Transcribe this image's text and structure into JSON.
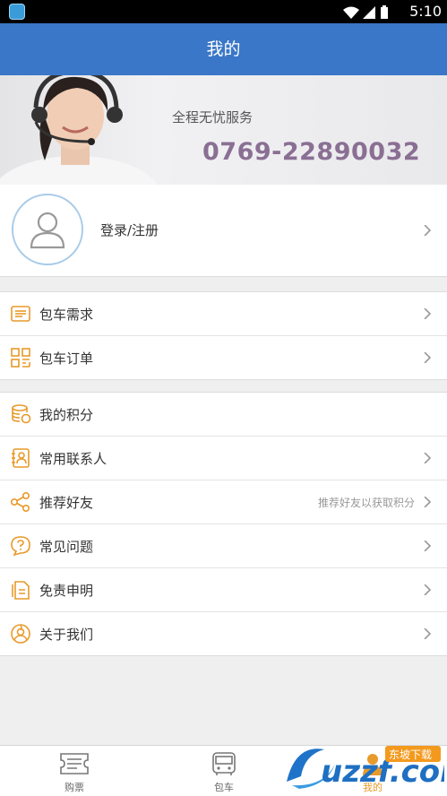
{
  "status_bar": {
    "time": "5:10"
  },
  "header": {
    "title": "我的"
  },
  "banner": {
    "slogan": "全程无忧服务",
    "phone": "0769-22890032"
  },
  "profile": {
    "login_label": "登录/注册"
  },
  "groups": [
    {
      "items": [
        {
          "label": "包车需求",
          "icon": "ticket-list-icon"
        },
        {
          "label": "包车订单",
          "icon": "qr-grid-icon"
        }
      ]
    },
    {
      "items": [
        {
          "label": "我的积分",
          "icon": "coin-stack-icon"
        },
        {
          "label": "常用联系人",
          "icon": "contact-card-icon"
        },
        {
          "label": "推荐好友",
          "icon": "share-icon",
          "hint": "推荐好友以获取积分"
        },
        {
          "label": "常见问题",
          "icon": "question-icon"
        },
        {
          "label": "免责申明",
          "icon": "document-icon"
        },
        {
          "label": "关于我们",
          "icon": "about-icon"
        }
      ]
    }
  ],
  "tabbar": {
    "tabs": [
      {
        "label": "购票",
        "icon": "ticket-icon"
      },
      {
        "label": "包车",
        "icon": "bus-icon"
      },
      {
        "label": "我的",
        "icon": "user-tab-icon",
        "active": true
      }
    ]
  },
  "watermark": {
    "text": "uzzf.com",
    "badge": "东坡下载"
  },
  "colors": {
    "primary": "#3a77c8",
    "accent": "#e89a2a",
    "phone": "#8a6f93"
  }
}
